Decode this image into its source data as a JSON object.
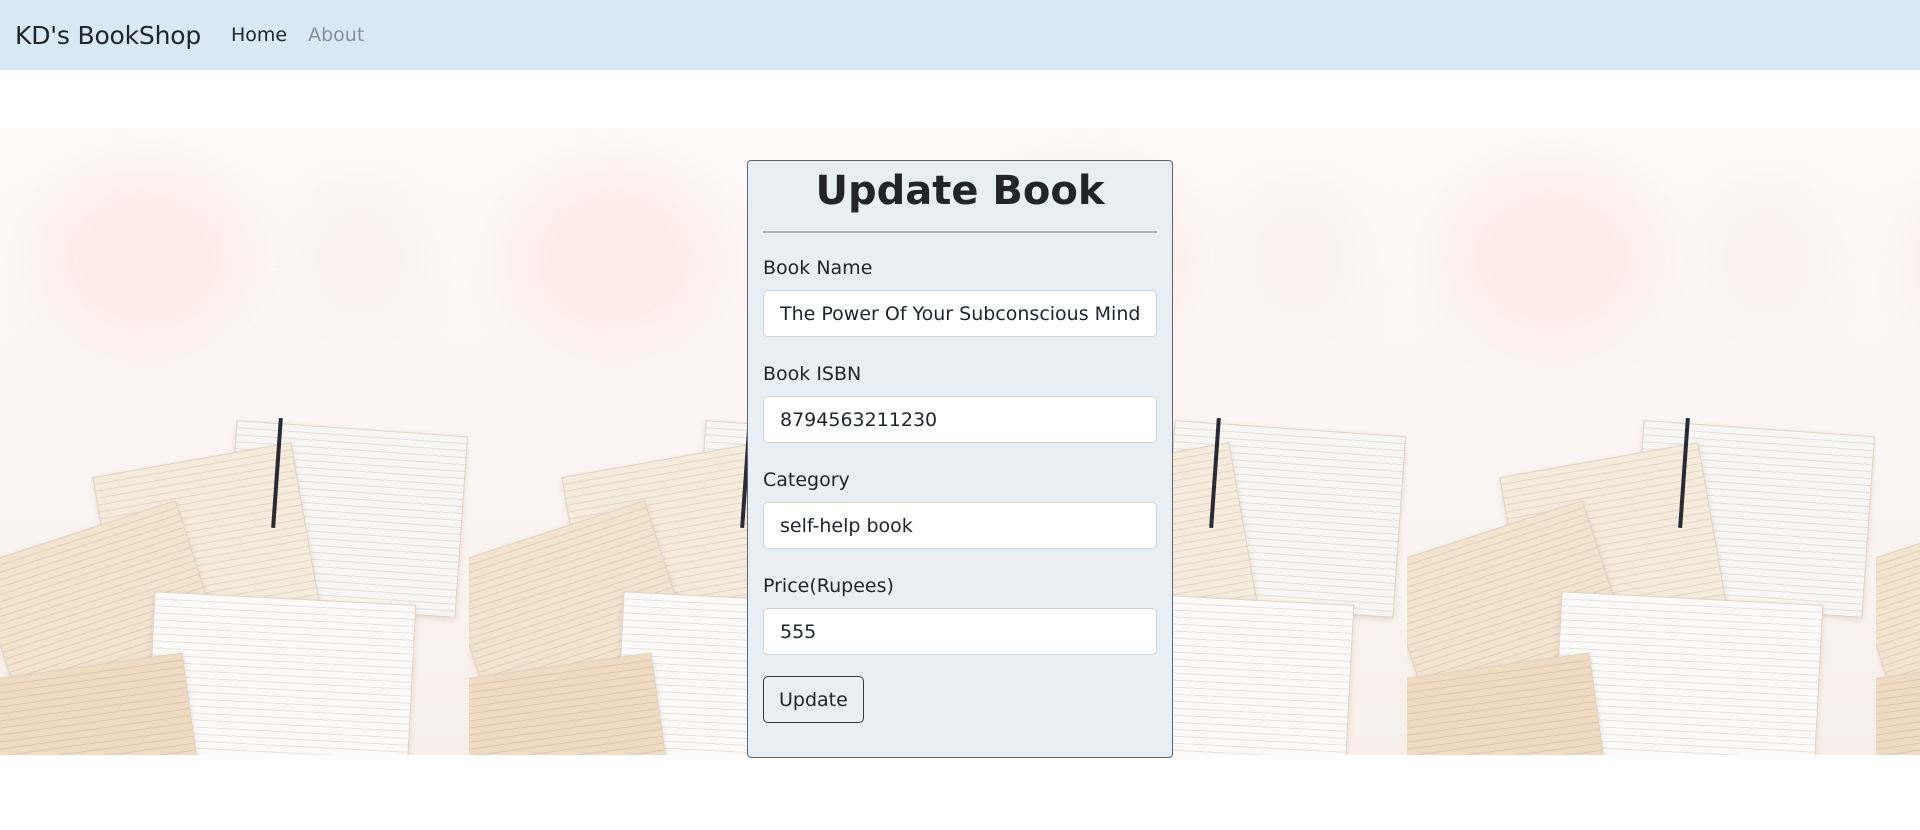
{
  "navbar": {
    "brand": "KD's BookShop",
    "links": [
      {
        "label": "Home",
        "active": true
      },
      {
        "label": "About",
        "active": false
      }
    ],
    "background": "#d8e9f5"
  },
  "form": {
    "title": "Update Book",
    "fields": {
      "book_name": {
        "label": "Book Name",
        "value": "The Power Of Your Subconscious Mind"
      },
      "book_isbn": {
        "label": "Book ISBN",
        "value": "8794563211230"
      },
      "category": {
        "label": "Category",
        "value": "self-help book"
      },
      "price": {
        "label": "Price(Rupees)",
        "value": "555"
      }
    },
    "submit_label": "Update",
    "card_background": "#e7eef4"
  },
  "background_image": {
    "description_icon": "open-books-pattern"
  }
}
